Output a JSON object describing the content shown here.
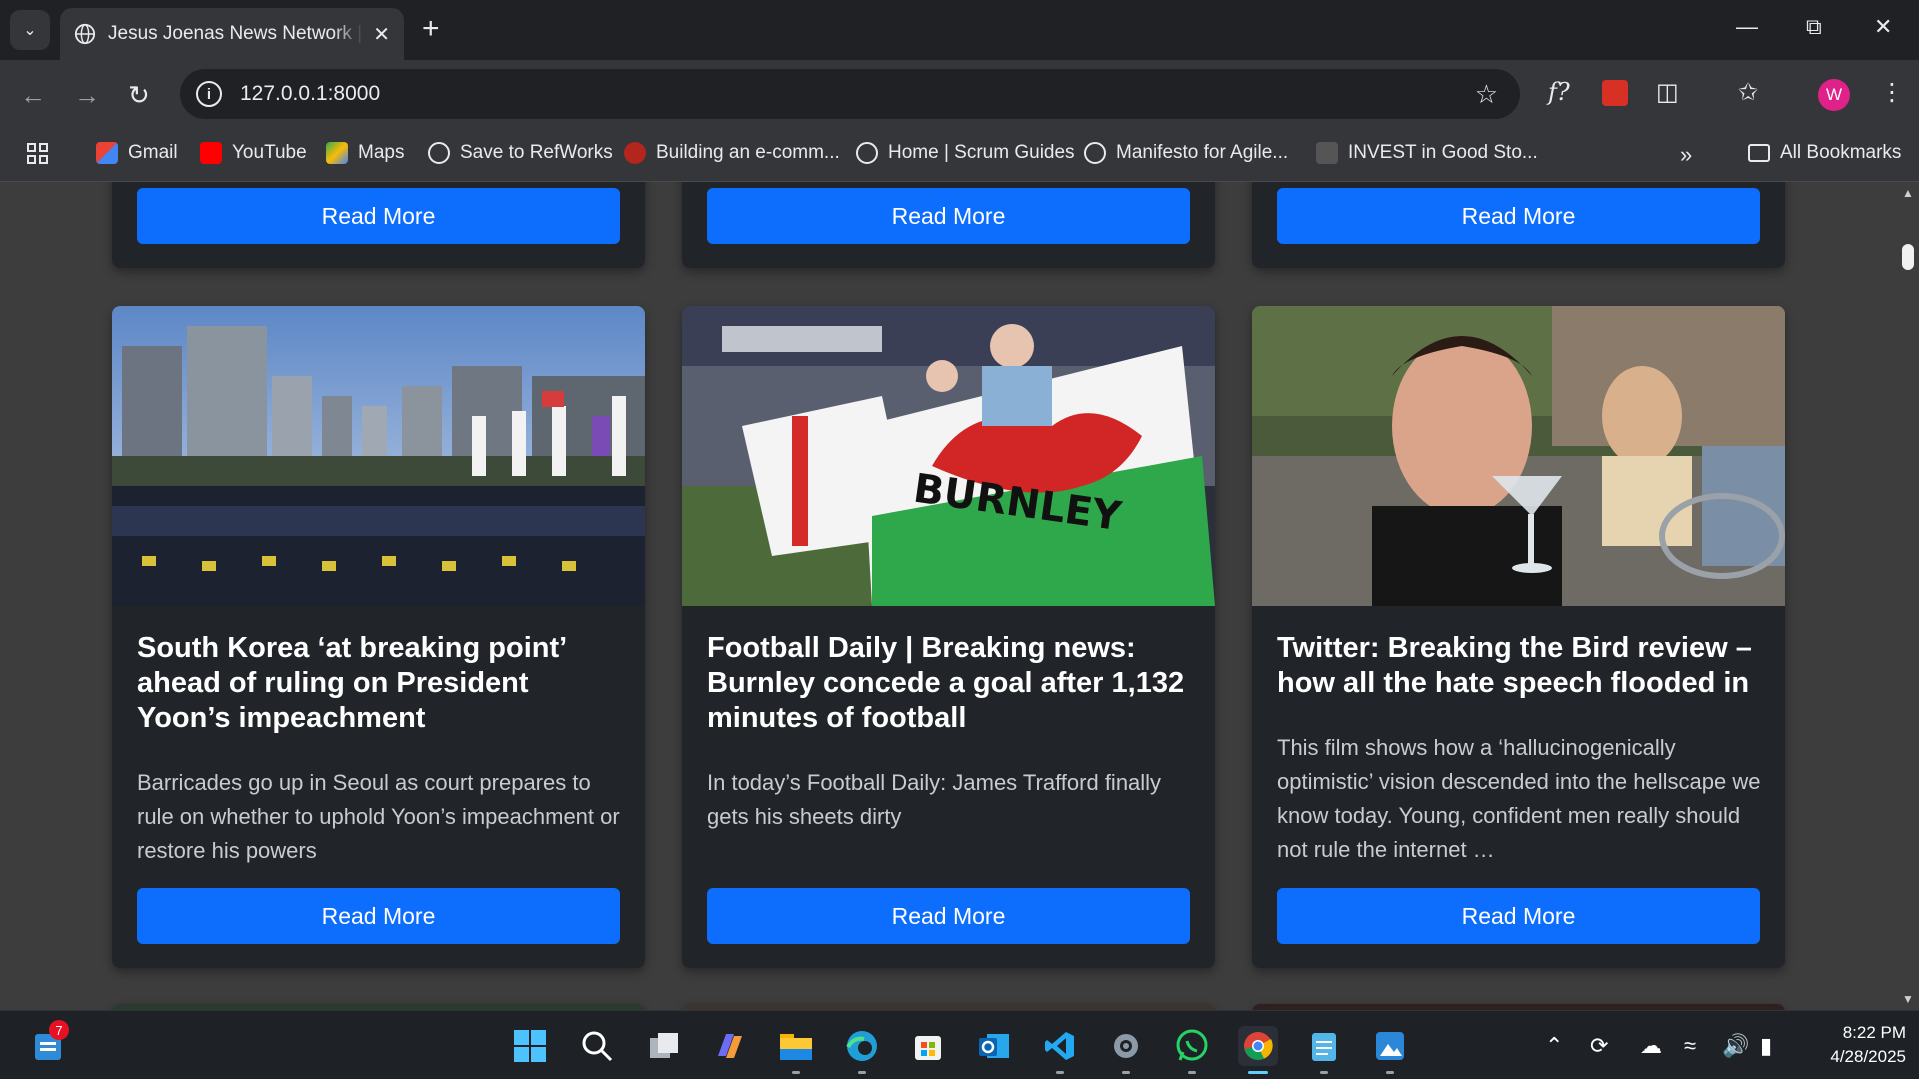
{
  "browser": {
    "tab": {
      "title": "Jesus Joenas News Network | Home"
    },
    "address": {
      "url": "127.0.0.1:8000"
    },
    "profile_initial": "W",
    "extension_label": "f?"
  },
  "bookmarks": [
    {
      "label": "Gmail",
      "icon": "gmail-icon"
    },
    {
      "label": "YouTube",
      "icon": "youtube-icon"
    },
    {
      "label": "Maps",
      "icon": "maps-icon"
    },
    {
      "label": "Save to RefWorks",
      "icon": "globe-icon"
    },
    {
      "label": "Building an e-comm...",
      "icon": "site-icon"
    },
    {
      "label": "Home | Scrum Guides",
      "icon": "globe-icon"
    },
    {
      "label": "Manifesto for Agile...",
      "icon": "globe-icon"
    },
    {
      "label": "INVEST in Good Sto...",
      "icon": "site-icon"
    }
  ],
  "all_bookmarks_label": "All Bookmarks",
  "top_row": {
    "button_label": "Read More"
  },
  "articles": [
    {
      "title": "South Korea ‘at breaking point’ ahead of ruling on President Yoon’s impeachment",
      "summary": "Barricades go up in Seoul as court prepares to rule on whether to uphold Yoon’s impeachment or restore his powers",
      "button_label": "Read More",
      "image": "protest-crowd-image"
    },
    {
      "title": "Football Daily | Breaking news: Burnley concede a goal after 1,132 minutes of football",
      "summary": "In today’s Football Daily: James Trafford finally gets his sheets dirty",
      "button_label": "Read More",
      "image": "burnley-fans-image"
    },
    {
      "title": "Twitter: Breaking the Bird review – how all the hate speech flooded in",
      "summary": "This film shows how a ‘hallucinogenically optimistic’ vision descended into the hellscape we know today. Young, confident men really should not rule the internet …",
      "button_label": "Read More",
      "image": "man-with-drink-image"
    }
  ],
  "taskbar": {
    "widget_badge": "7",
    "time": "8:22 PM",
    "date": "4/28/2025"
  },
  "colors": {
    "accent": "#0d6efd",
    "card": "#212529",
    "page": "#3d3d3d"
  }
}
